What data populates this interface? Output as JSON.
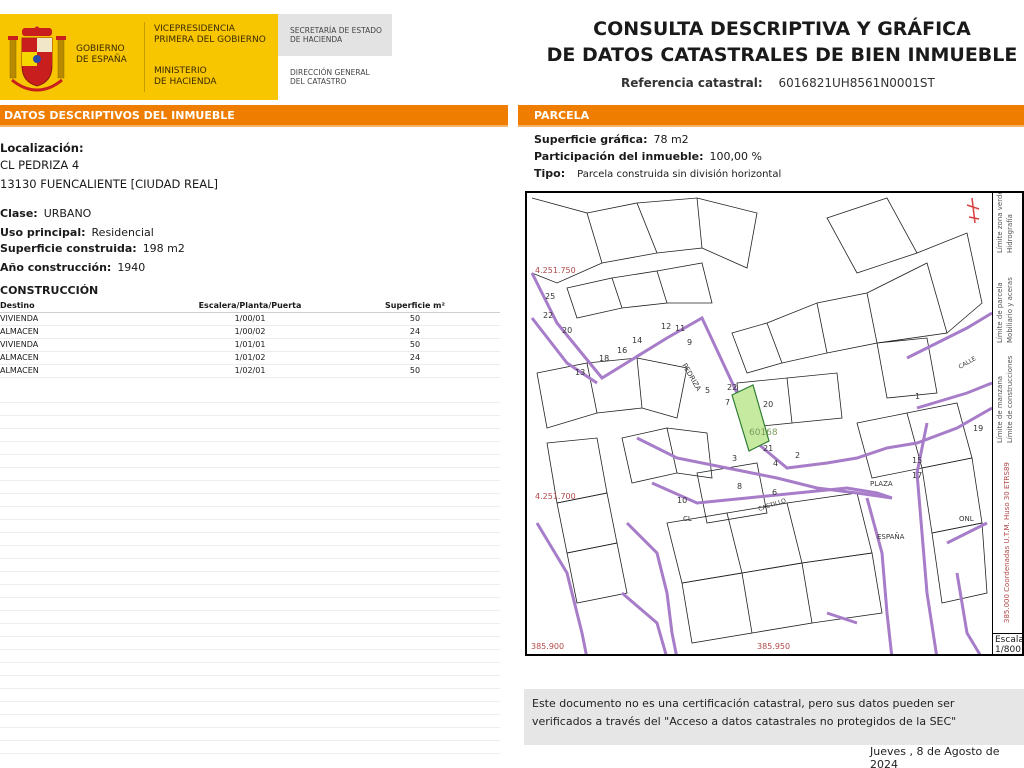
{
  "header": {
    "gov_name": "GOBIERNO\nDE ESPAÑA",
    "vp_name": "VICEPRESIDENCIA\nPRIMERA DEL GOBIERNO",
    "min_name": "MINISTERIO\nDE HACIENDA",
    "sec_name": "SECRETARÍA DE ESTADO\nDE HACIENDA",
    "dir_name": "DIRECCIÓN GENERAL\nDEL CATASTRO",
    "title_line1": "CONSULTA DESCRIPTIVA Y GRÁFICA",
    "title_line2": "DE DATOS CATASTRALES DE BIEN INMUEBLE",
    "ref_label": "Referencia catastral:",
    "ref_value": "6016821UH8561N0001ST",
    "brand_color": "#f7c600",
    "accent_color": "#ef7d00"
  },
  "left": {
    "section_title": "DATOS DESCRIPTIVOS DEL INMUEBLE",
    "loc_label": "Localización:",
    "loc_line1": "CL PEDRIZA 4",
    "loc_line2": "13130 FUENCALIENTE [CIUDAD REAL]",
    "clase_label": "Clase:",
    "clase_value": "URBANO",
    "uso_label": "Uso principal:",
    "uso_value": "Residencial",
    "sup_label": "Superficie construida:",
    "sup_value": "198 m2",
    "anio_label": "Año construcción:",
    "anio_value": "1940",
    "const_title": "CONSTRUCCIÓN",
    "table": {
      "headers": [
        "Destino",
        "Escalera/Planta/Puerta",
        "Superficie m²"
      ],
      "rows": [
        [
          "VIVIENDA",
          "1/00/01",
          "50"
        ],
        [
          "ALMACEN",
          "1/00/02",
          "24"
        ],
        [
          "VIVIENDA",
          "1/01/01",
          "50"
        ],
        [
          "ALMACEN",
          "1/01/02",
          "24"
        ],
        [
          "ALMACEN",
          "1/02/01",
          "50"
        ]
      ]
    }
  },
  "right": {
    "section_title": "PARCELA",
    "sup_grafica_label": "Superficie gráfica:",
    "sup_grafica_value": "78 m2",
    "participacion_label": "Participación del inmueble:",
    "participacion_value": "100,00 %",
    "tipo_label": "Tipo:",
    "tipo_value": "Parcela construida sin división horizontal",
    "map": {
      "coord_top": "4.251.750",
      "coord_mid": "4.251.700",
      "coord_bl": "385.900",
      "coord_bc": "385.950",
      "parcel_label": "60168",
      "street_labels": [
        "PEDRIZA",
        "PLAZA",
        "CASTILLO",
        "CL",
        "ESPAÑA",
        "CALLE",
        "ONL"
      ],
      "house_numbers": [
        "22",
        "20",
        "21",
        "2",
        "4",
        "6",
        "8",
        "10",
        "12",
        "14",
        "16",
        "18",
        "20",
        "22",
        "25",
        "13",
        "15",
        "17",
        "19",
        "1",
        "3",
        "5",
        "7",
        "9",
        "11"
      ],
      "legend": [
        "Límite zona verde",
        "Hidrografía",
        "Límite de parcela",
        "Mobiliario y aceras",
        "Límite de manzana",
        "Límite de construcciones"
      ],
      "utm_note": "385.000 Coordenadas U.T.M. Huso 30 ETRS89",
      "escala_label": "Escala:",
      "escala_value": "1/800",
      "parcel_fill": "#c6eaa0",
      "block_line_color": "#a77cc8"
    }
  },
  "footer": {
    "disclaimer": "Este documento no es una certificación catastral, pero sus datos pueden ser verificados a través del \"Acceso a datos catastrales no protegidos de la SEC\"",
    "date": "Jueves , 8 de Agosto de 2024"
  }
}
